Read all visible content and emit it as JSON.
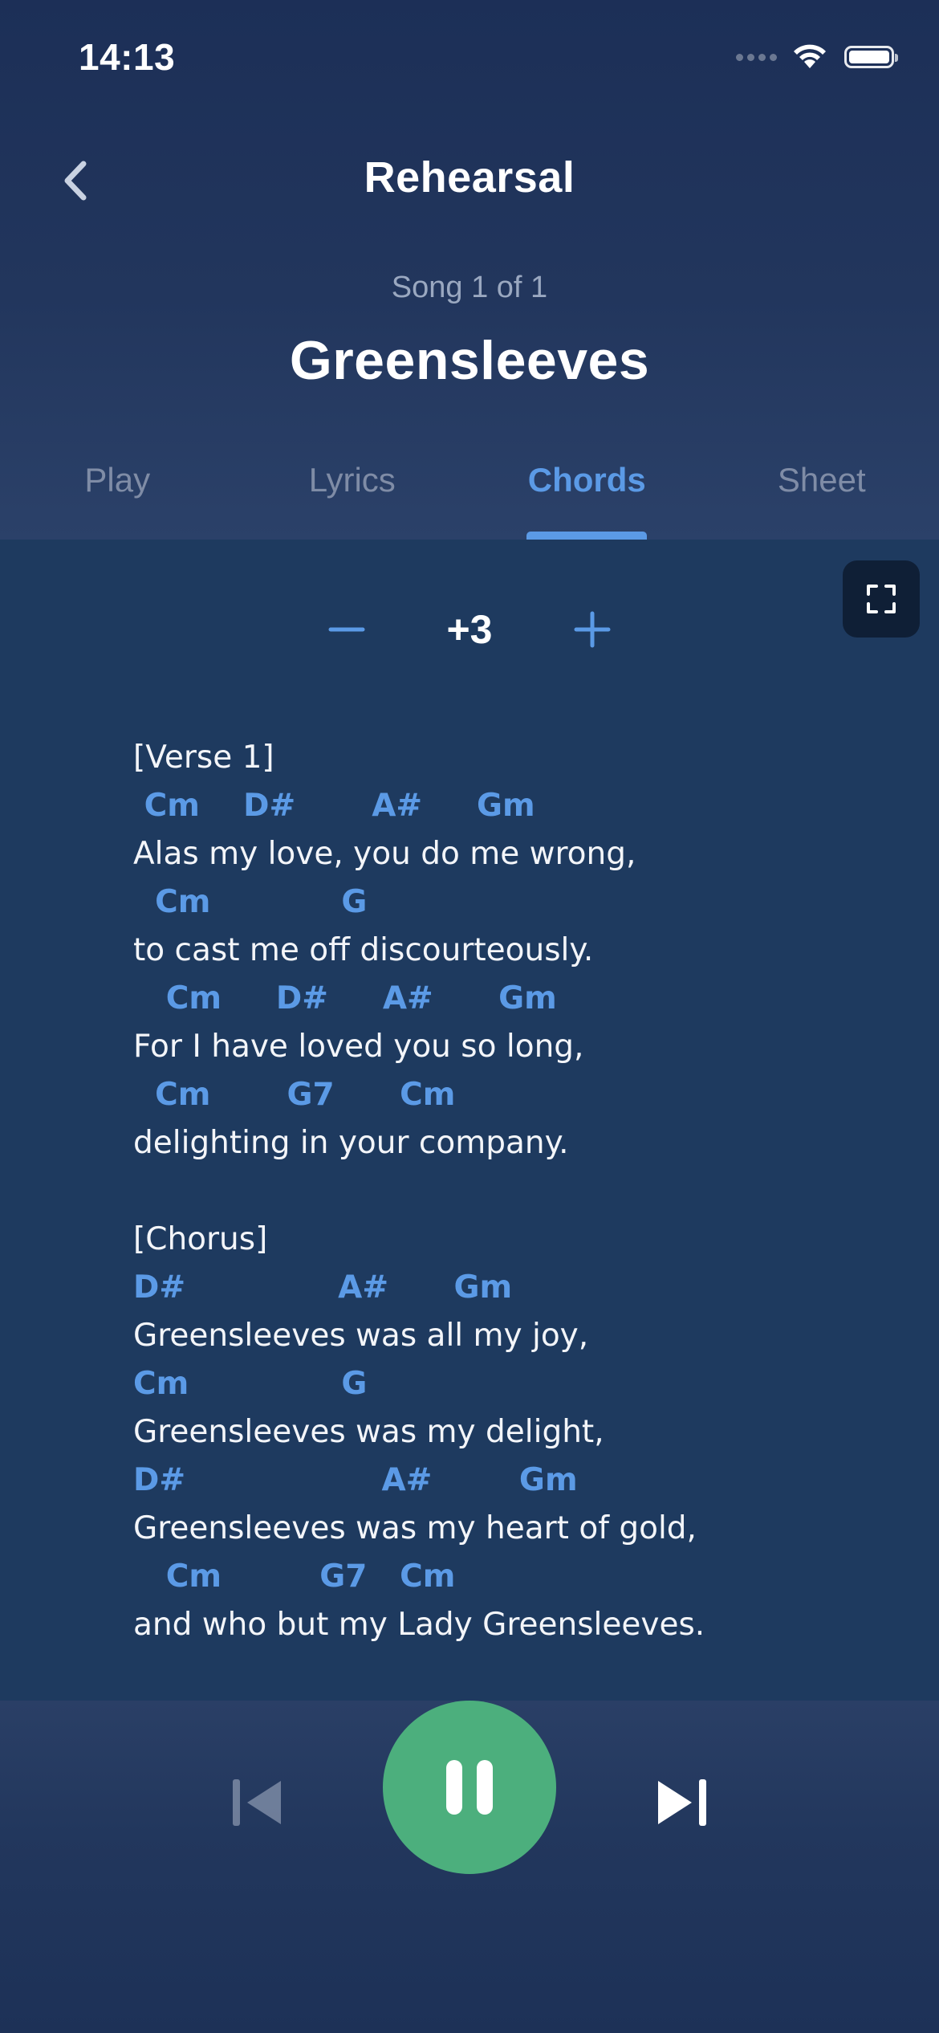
{
  "status_bar": {
    "time": "14:13"
  },
  "header": {
    "title": "Rehearsal",
    "song_counter": "Song 1 of 1",
    "song_title": "Greensleeves"
  },
  "tabs": [
    {
      "label": "Play",
      "active": false
    },
    {
      "label": "Lyrics",
      "active": false
    },
    {
      "label": "Chords",
      "active": true
    },
    {
      "label": "Sheet",
      "active": false
    }
  ],
  "transpose": {
    "value": "+3"
  },
  "sheet": {
    "lines": [
      {
        "type": "section",
        "text": "[Verse 1]"
      },
      {
        "type": "chord",
        "text": " Cm    D#       A#     Gm"
      },
      {
        "type": "lyric",
        "text": "Alas my love, you do me wrong,"
      },
      {
        "type": "chord",
        "text": "  Cm            G"
      },
      {
        "type": "lyric",
        "text": "to cast me off discourteously."
      },
      {
        "type": "chord",
        "text": "   Cm     D#     A#      Gm"
      },
      {
        "type": "lyric",
        "text": "For I have loved you so long,"
      },
      {
        "type": "chord",
        "text": "  Cm       G7      Cm"
      },
      {
        "type": "lyric",
        "text": "delighting in your company."
      },
      {
        "type": "blank",
        "text": ""
      },
      {
        "type": "section",
        "text": "[Chorus]"
      },
      {
        "type": "chord",
        "text": "D#              A#      Gm"
      },
      {
        "type": "lyric",
        "text": "Greensleeves was all my joy,"
      },
      {
        "type": "chord",
        "text": "Cm              G"
      },
      {
        "type": "lyric",
        "text": "Greensleeves was my delight,"
      },
      {
        "type": "chord",
        "text": "D#                  A#        Gm"
      },
      {
        "type": "lyric",
        "text": "Greensleeves was my heart of gold,"
      },
      {
        "type": "chord",
        "text": "   Cm         G7   Cm"
      },
      {
        "type": "lyric",
        "text": "and who but my Lady Greensleeves."
      }
    ]
  },
  "colors": {
    "background": "#1e3a5f",
    "accent": "#5b9ae6",
    "play_button": "#4caf7d",
    "muted_text": "#7f8ca6"
  },
  "icons": {
    "back": "chevron-left-icon",
    "minus": "minus-icon",
    "plus": "plus-icon",
    "fullscreen": "fullscreen-icon",
    "previous": "skip-previous-icon",
    "pause": "pause-icon",
    "next": "skip-next-icon"
  }
}
